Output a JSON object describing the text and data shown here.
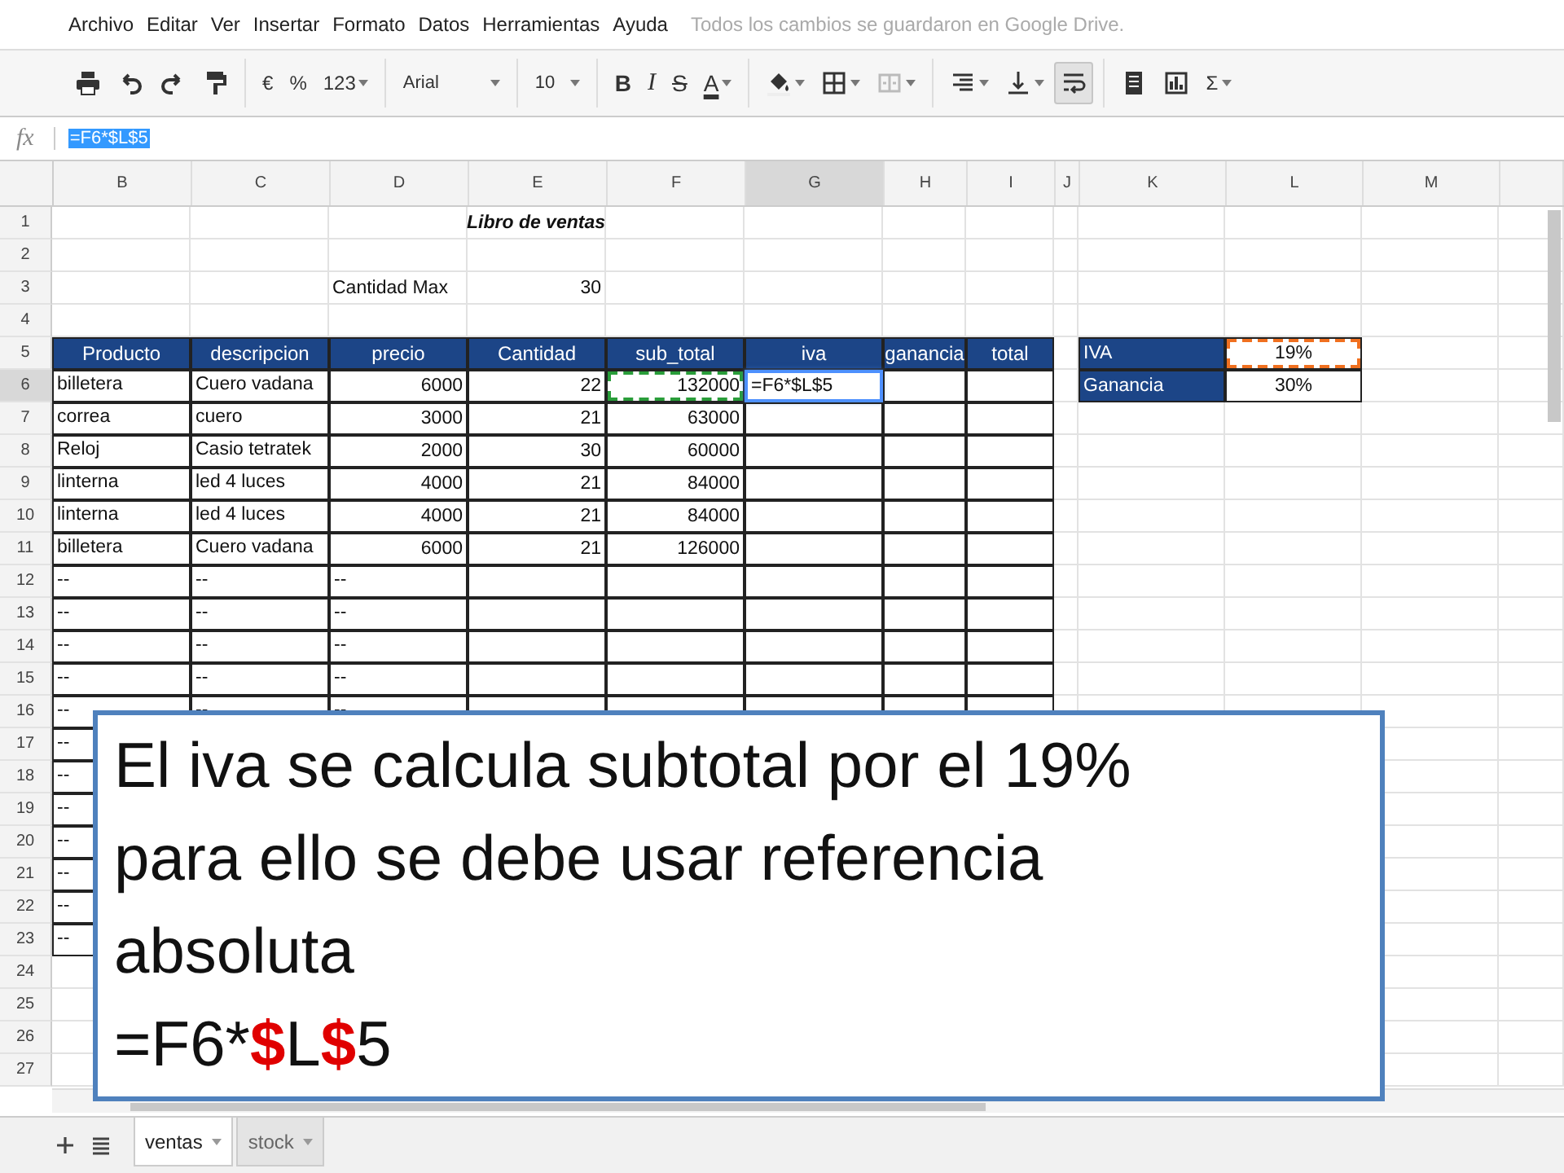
{
  "menu": {
    "items": [
      "Archivo",
      "Editar",
      "Ver",
      "Insertar",
      "Formato",
      "Datos",
      "Herramientas",
      "Ayuda"
    ],
    "status": "Todos los cambios se guardaron en Google Drive."
  },
  "toolbar": [
    {
      "items": [
        {
          "kind": "print"
        },
        {
          "kind": "undo"
        },
        {
          "kind": "redo"
        },
        {
          "kind": "paint"
        }
      ]
    },
    {
      "items": [
        {
          "kind": "text",
          "label": "€"
        },
        {
          "kind": "text",
          "label": "%"
        },
        {
          "kind": "text",
          "label": "123",
          "dropdown": true
        }
      ]
    },
    {
      "items": [
        {
          "kind": "select",
          "label": "Arial"
        }
      ]
    },
    {
      "items": [
        {
          "kind": "select",
          "label": "10"
        }
      ]
    },
    {
      "items": [
        {
          "kind": "bold",
          "label": "B"
        },
        {
          "kind": "italic",
          "label": "I"
        },
        {
          "kind": "strike",
          "label": "S"
        },
        {
          "kind": "textcolor",
          "label": "A",
          "dropdown": true
        }
      ]
    },
    {
      "items": [
        {
          "kind": "fill",
          "dropdown": true
        },
        {
          "kind": "borders",
          "dropdown": true
        },
        {
          "kind": "merge",
          "dropdown": true
        }
      ]
    },
    {
      "items": [
        {
          "kind": "halign",
          "dropdown": true
        },
        {
          "kind": "valign",
          "dropdown": true
        },
        {
          "kind": "wrap",
          "on": true
        }
      ]
    },
    {
      "items": [
        {
          "kind": "comment"
        },
        {
          "kind": "chart"
        },
        {
          "kind": "text",
          "label": "Σ",
          "dropdown": true
        }
      ]
    }
  ],
  "formula_bar": {
    "label": "fx",
    "value": "=F6*$L$5"
  },
  "columns": [
    {
      "label": "B",
      "selected": false
    },
    {
      "label": "C",
      "selected": false
    },
    {
      "label": "D",
      "selected": false
    },
    {
      "label": "E",
      "selected": false
    },
    {
      "label": "F",
      "selected": false
    },
    {
      "label": "G",
      "selected": true
    },
    {
      "label": "H",
      "selected": false
    },
    {
      "label": "I",
      "selected": false
    },
    {
      "label": "J",
      "selected": false
    },
    {
      "label": "K",
      "selected": false
    },
    {
      "label": "L",
      "selected": false
    },
    {
      "label": "M",
      "selected": false
    }
  ],
  "rows": [
    {
      "number": "1",
      "selected": false,
      "cells": [
        null,
        null,
        null,
        {
          "kind": "title",
          "text": "Libro de ventas"
        },
        null,
        null,
        null,
        null,
        null,
        null,
        null,
        null
      ]
    },
    {
      "number": "2",
      "selected": false,
      "cells": [
        null,
        null,
        null,
        null,
        null,
        null,
        null,
        null,
        null,
        null,
        null,
        null
      ]
    },
    {
      "number": "3",
      "selected": false,
      "cells": [
        null,
        null,
        {
          "kind": "text",
          "text": "Cantidad Max"
        },
        {
          "kind": "number",
          "text": "30"
        },
        null,
        null,
        null,
        null,
        null,
        null,
        null,
        null
      ]
    },
    {
      "number": "4",
      "selected": false,
      "cells": [
        null,
        null,
        null,
        null,
        null,
        null,
        null,
        null,
        null,
        null,
        null,
        null
      ]
    },
    {
      "number": "5",
      "selected": false,
      "cells": [
        {
          "kind": "header",
          "text": "Producto"
        },
        {
          "kind": "header",
          "text": "descripcion"
        },
        {
          "kind": "header",
          "text": "precio"
        },
        {
          "kind": "header",
          "text": "Cantidad"
        },
        {
          "kind": "header",
          "text": "sub_total"
        },
        {
          "kind": "header",
          "text": "iva"
        },
        {
          "kind": "header",
          "text": "ganancia"
        },
        {
          "kind": "header",
          "text": "total"
        },
        null,
        {
          "kind": "label",
          "text": "IVA"
        },
        {
          "kind": "value",
          "text": "19%",
          "color": "#f07020"
        },
        null
      ]
    },
    {
      "number": "6",
      "selected": true,
      "cells": [
        {
          "kind": "item",
          "text": "billetera"
        },
        {
          "kind": "item",
          "text": "Cuero vadana"
        },
        {
          "kind": "amount",
          "text": "6000"
        },
        {
          "kind": "amount",
          "text": "22"
        },
        {
          "kind": "amount",
          "text": "132000",
          "color": "#2a9d3a"
        },
        {
          "kind": "item",
          "text": "=F6*$L$5"
        },
        {
          "kind": "boxed"
        },
        {
          "kind": "boxed"
        },
        null,
        {
          "kind": "label",
          "text": "Ganancia"
        },
        {
          "kind": "value",
          "text": "30%"
        },
        null
      ]
    },
    {
      "number": "7",
      "selected": false,
      "cells": [
        {
          "kind": "item",
          "text": "correa"
        },
        {
          "kind": "item",
          "text": "cuero"
        },
        {
          "kind": "amount",
          "text": "3000"
        },
        {
          "kind": "amount",
          "text": "21"
        },
        {
          "kind": "amount",
          "text": "63000"
        },
        {
          "kind": "boxed"
        },
        {
          "kind": "boxed"
        },
        {
          "kind": "boxed"
        },
        null,
        null,
        null,
        null
      ]
    },
    {
      "number": "8",
      "selected": false,
      "cells": [
        {
          "kind": "item",
          "text": "Reloj"
        },
        {
          "kind": "item",
          "text": "Casio tetratek"
        },
        {
          "kind": "amount",
          "text": "2000"
        },
        {
          "kind": "amount",
          "text": "30"
        },
        {
          "kind": "amount",
          "text": "60000"
        },
        {
          "kind": "boxed"
        },
        {
          "kind": "boxed"
        },
        {
          "kind": "boxed"
        },
        null,
        null,
        null,
        null
      ]
    },
    {
      "number": "9",
      "selected": false,
      "cells": [
        {
          "kind": "item",
          "text": "linterna"
        },
        {
          "kind": "item",
          "text": "led 4 luces"
        },
        {
          "kind": "amount",
          "text": "4000"
        },
        {
          "kind": "amount",
          "text": "21"
        },
        {
          "kind": "amount",
          "text": "84000"
        },
        {
          "kind": "boxed"
        },
        {
          "kind": "boxed"
        },
        {
          "kind": "boxed"
        },
        null,
        null,
        null,
        null
      ]
    },
    {
      "number": "10",
      "selected": false,
      "cells": [
        {
          "kind": "item",
          "text": "linterna"
        },
        {
          "kind": "item",
          "text": "led 4 luces"
        },
        {
          "kind": "amount",
          "text": "4000"
        },
        {
          "kind": "amount",
          "text": "21"
        },
        {
          "kind": "amount",
          "text": "84000"
        },
        {
          "kind": "boxed"
        },
        {
          "kind": "boxed"
        },
        {
          "kind": "boxed"
        },
        null,
        null,
        null,
        null
      ]
    },
    {
      "number": "11",
      "selected": false,
      "cells": [
        {
          "kind": "item",
          "text": "billetera"
        },
        {
          "kind": "item",
          "text": "Cuero vadana"
        },
        {
          "kind": "amount",
          "text": "6000"
        },
        {
          "kind": "amount",
          "text": "21"
        },
        {
          "kind": "amount",
          "text": "126000"
        },
        {
          "kind": "boxed"
        },
        {
          "kind": "boxed"
        },
        {
          "kind": "boxed"
        },
        null,
        null,
        null,
        null
      ]
    },
    {
      "number": "12",
      "selected": false,
      "cells": [
        {
          "kind": "item",
          "text": "--"
        },
        {
          "kind": "item",
          "text": "--"
        },
        {
          "kind": "item",
          "text": "--"
        },
        {
          "kind": "boxed"
        },
        {
          "kind": "boxed"
        },
        {
          "kind": "boxed"
        },
        {
          "kind": "boxed"
        },
        {
          "kind": "boxed"
        },
        null,
        null,
        null,
        null
      ]
    },
    {
      "number": "13",
      "selected": false,
      "cells": [
        {
          "kind": "item",
          "text": "--"
        },
        {
          "kind": "item",
          "text": "--"
        },
        {
          "kind": "item",
          "text": "--"
        },
        {
          "kind": "boxed"
        },
        {
          "kind": "boxed"
        },
        {
          "kind": "boxed"
        },
        {
          "kind": "boxed"
        },
        {
          "kind": "boxed"
        },
        null,
        null,
        null,
        null
      ]
    },
    {
      "number": "14",
      "selected": false,
      "cells": [
        {
          "kind": "item",
          "text": "--"
        },
        {
          "kind": "item",
          "text": "--"
        },
        {
          "kind": "item",
          "text": "--"
        },
        {
          "kind": "boxed"
        },
        {
          "kind": "boxed"
        },
        {
          "kind": "boxed"
        },
        {
          "kind": "boxed"
        },
        {
          "kind": "boxed"
        },
        null,
        null,
        null,
        null
      ]
    },
    {
      "number": "15",
      "selected": false,
      "cells": [
        {
          "kind": "item",
          "text": "--"
        },
        {
          "kind": "item",
          "text": "--"
        },
        {
          "kind": "item",
          "text": "--"
        },
        {
          "kind": "boxed"
        },
        {
          "kind": "boxed"
        },
        {
          "kind": "boxed"
        },
        {
          "kind": "boxed"
        },
        {
          "kind": "boxed"
        },
        null,
        null,
        null,
        null
      ]
    },
    {
      "number": "16",
      "selected": false,
      "cells": [
        {
          "kind": "item",
          "text": "--"
        },
        {
          "kind": "item",
          "text": "--"
        },
        {
          "kind": "item",
          "text": "--"
        },
        {
          "kind": "boxed"
        },
        {
          "kind": "boxed"
        },
        {
          "kind": "boxed"
        },
        {
          "kind": "boxed"
        },
        {
          "kind": "boxed"
        },
        null,
        null,
        null,
        null
      ]
    },
    {
      "number": "17",
      "selected": false,
      "cells": [
        {
          "kind": "item",
          "text": "--"
        },
        null,
        null,
        null,
        null,
        null,
        null,
        null,
        null,
        null,
        null,
        null
      ]
    },
    {
      "number": "18",
      "selected": false,
      "cells": [
        {
          "kind": "item",
          "text": "--"
        },
        null,
        null,
        null,
        null,
        null,
        null,
        null,
        null,
        null,
        null,
        null
      ]
    },
    {
      "number": "19",
      "selected": false,
      "cells": [
        {
          "kind": "item",
          "text": "--"
        },
        null,
        null,
        null,
        null,
        null,
        null,
        null,
        null,
        null,
        null,
        null
      ]
    },
    {
      "number": "20",
      "selected": false,
      "cells": [
        {
          "kind": "item",
          "text": "--"
        },
        null,
        null,
        null,
        null,
        null,
        null,
        null,
        null,
        null,
        null,
        null
      ]
    },
    {
      "number": "21",
      "selected": false,
      "cells": [
        {
          "kind": "item",
          "text": "--"
        },
        null,
        null,
        null,
        null,
        null,
        null,
        null,
        null,
        null,
        null,
        null
      ]
    },
    {
      "number": "22",
      "selected": false,
      "cells": [
        {
          "kind": "item",
          "text": "--"
        },
        null,
        null,
        null,
        null,
        null,
        null,
        null,
        null,
        null,
        null,
        null
      ]
    },
    {
      "number": "23",
      "selected": false,
      "cells": [
        {
          "kind": "item",
          "text": "--"
        },
        null,
        null,
        null,
        null,
        null,
        null,
        null,
        null,
        null,
        null,
        null
      ]
    },
    {
      "number": "24",
      "selected": false,
      "cells": [
        null,
        null,
        null,
        null,
        null,
        null,
        null,
        null,
        null,
        null,
        null,
        null
      ]
    },
    {
      "number": "25",
      "selected": false,
      "cells": [
        null,
        null,
        null,
        null,
        null,
        null,
        null,
        null,
        null,
        null,
        null,
        null
      ]
    },
    {
      "number": "26",
      "selected": false,
      "cells": [
        null,
        null,
        null,
        null,
        null,
        null,
        null,
        null,
        null,
        null,
        null,
        null
      ]
    },
    {
      "number": "27",
      "selected": false,
      "cells": [
        null,
        null,
        null,
        null,
        null,
        null,
        null,
        null,
        null,
        null,
        null,
        null
      ]
    }
  ],
  "sheet_tabs": [
    {
      "label": "ventas",
      "selected": true
    },
    {
      "label": "stock",
      "selected": false
    }
  ],
  "callout": {
    "text": "El iva se calcula subtotal por el 19% para ello se debe usar referencia absoluta",
    "formula": [
      {
        "kind": "plain",
        "text": "=F6*"
      },
      {
        "kind": "mark",
        "text": "$"
      },
      {
        "kind": "plain",
        "text": "L"
      },
      {
        "kind": "mark",
        "text": "$"
      },
      {
        "kind": "plain",
        "text": "5"
      }
    ]
  }
}
